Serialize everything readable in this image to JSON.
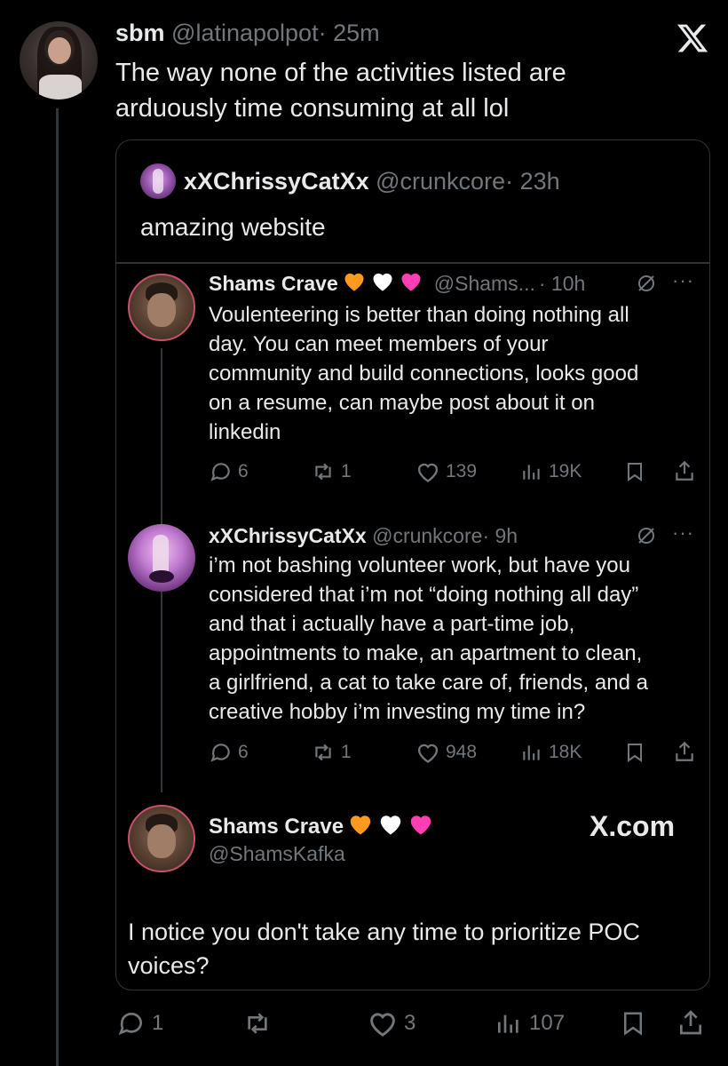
{
  "app": {
    "logo_text": "X"
  },
  "main_tweet": {
    "display_name": "sbm",
    "handle": "@latinapolpot",
    "time": "· 25m",
    "text_line1": "The way none of the activities listed are",
    "text_line2": "arduously time consuming at all lol",
    "metrics": {
      "replies": "1",
      "retweets": "",
      "likes": "3",
      "views": "107"
    }
  },
  "quoted_tweet": {
    "display_name": "xXChrissyCatXx",
    "handle": "@crunkcore",
    "time": "· 23h",
    "text": "amazing website"
  },
  "reply1": {
    "display_name": "Shams Crave",
    "handle": "@Shams...",
    "time": "· 10h",
    "lines": [
      "Voulenteering is better than doing nothing all",
      "day. You can meet members of your",
      "community and build connections, looks good",
      "on a resume, can maybe post about it on",
      "linkedin"
    ],
    "metrics": {
      "replies": "6",
      "retweets": "1",
      "likes": "139",
      "views": "19K"
    }
  },
  "reply2": {
    "display_name": "xXChrissyCatXx",
    "handle": "@crunkcore",
    "time": "· 9h",
    "lines": [
      "i’m not bashing volunteer work, but have you",
      "considered that i’m not “doing nothing all day”",
      "and that i actually have a part-time job,",
      "appointments to make, an apartment to clean,",
      "a girlfriend, a cat to take care of, friends, and a",
      "creative hobby i’m investing my time in?"
    ],
    "metrics": {
      "replies": "6",
      "retweets": "1",
      "likes": "948",
      "views": "18K"
    }
  },
  "reply3": {
    "display_name": "Shams Crave",
    "handle": "@ShamsKafka",
    "watermark": "X.com",
    "line1": "I notice you don't take any time to prioritize POC",
    "line2": "voices?"
  },
  "colors": {
    "background": "#000000",
    "text": "#e7e9ea",
    "secondary": "#71767b",
    "border": "#2f3336",
    "heart_orange": "#ff9a1f",
    "heart_white": "#ffffff",
    "heart_pink": "#ff3fb3"
  },
  "icons": [
    "x-logo",
    "reply-icon",
    "retweet-icon",
    "like-icon",
    "views-icon",
    "bookmark-icon",
    "share-icon",
    "grok-icon",
    "more-icon",
    "heart-emoji"
  ]
}
